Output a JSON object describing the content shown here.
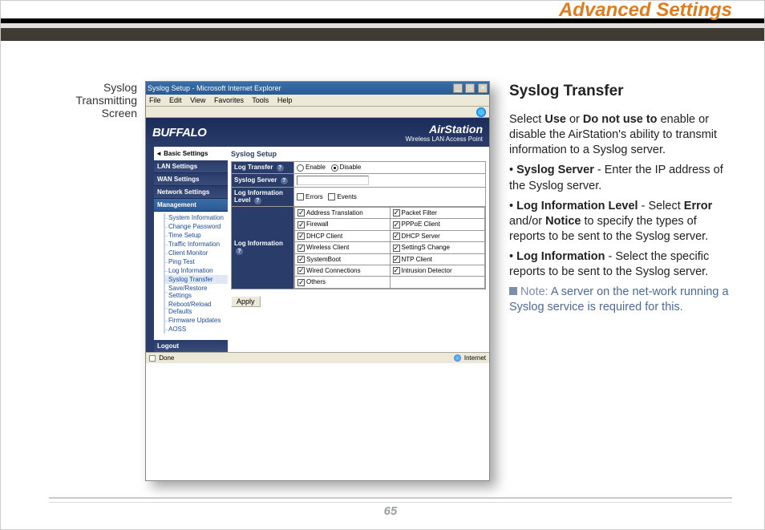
{
  "header": {
    "title": "Advanced Settings"
  },
  "caption": {
    "line1": "Syslog",
    "line2": "Transmitting",
    "line3": "Screen"
  },
  "browser": {
    "window_title": "Syslog Setup - Microsoft Internet Explorer",
    "menu": {
      "file": "File",
      "edit": "Edit",
      "view": "View",
      "favorites": "Favorites",
      "tools": "Tools",
      "help": "Help"
    },
    "status_done": "Done",
    "status_zone": "Internet",
    "win_min": "_",
    "win_max": "□",
    "win_close": "×"
  },
  "banner": {
    "brand": "BUFFALO",
    "product": "AirStation",
    "subtitle": "Wireless LAN Access Point"
  },
  "sidebar": {
    "basic": "◄ Basic Settings",
    "nav": {
      "lan": "LAN Settings",
      "wan": "WAN Settings",
      "network": "Network Settings",
      "management": "Management"
    },
    "sub": {
      "sys_info": "System Information",
      "change_pw": "Change Password",
      "time_setup": "Time Setup",
      "traffic": "Traffic Information",
      "client_mon": "Client Monitor",
      "ping": "Ping Test",
      "log_info": "Log Information",
      "syslog_transfer": "Syslog Transfer",
      "save_restore": "Save/Restore Settings",
      "reboot": "Reboot/Reload Defaults",
      "firmware": "Firmware Updates",
      "aoss": "AOSS"
    },
    "logout": "Logout"
  },
  "panel": {
    "heading": "Syslog Setup",
    "rows": {
      "log_transfer": "Log Transfer",
      "syslog_server": "Syslog Server",
      "log_info_level": "Log Information Level",
      "log_information": "Log Information"
    },
    "radio": {
      "enable": "Enable",
      "disable": "Disable"
    },
    "level": {
      "errors": "Errors",
      "events": "Events"
    },
    "items": {
      "addr_trans": "Address Translation",
      "packet_filter": "Packet Filter",
      "firewall": "Firewall",
      "pppoe": "PPPoE Client",
      "dhcp_client": "DHCP Client",
      "dhcp_server": "DHCP Server",
      "wireless_client": "Wireless Client",
      "settings_change": "SettingS Change",
      "system_boot": "SystemBoot",
      "ntp_client": "NTP Client",
      "wired_conn": "Wired Connections",
      "intrusion": "Intrusion Detector",
      "others": "Others"
    },
    "apply": "Apply"
  },
  "explain": {
    "title": "Syslog Transfer",
    "intro_a": "Select ",
    "intro_b": "Use",
    "intro_c": " or ",
    "intro_d": "Do not use to",
    "intro_e": " enable or disable the AirStation's ability to transmit information to a Syslog server.",
    "b1_label": "Syslog Server",
    "b1_text": " - Enter the IP address of the Syslog server.",
    "b2_label": "Log Information Level",
    "b2_text_a": " - Select ",
    "b2_err": "Error",
    "b2_andor": " and/or ",
    "b2_not": "Notice",
    "b2_text_b": " to specify the types of reports to be sent to the Syslog server.",
    "b3_label": "Log Information",
    "b3_text": " - Select the specific reports to be sent to the Syslog server.",
    "note_label": "Note:",
    "note_text": "  A server on the net-work running a Syslog service is required for this."
  },
  "footer": {
    "page": "65"
  }
}
